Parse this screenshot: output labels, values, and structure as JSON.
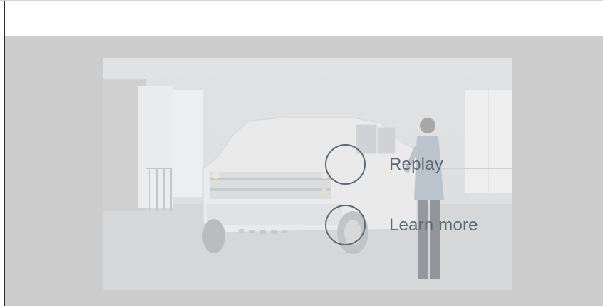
{
  "player": {
    "end_screen": {
      "actions": [
        {
          "label": "Replay",
          "icon": "replay-ring-icon"
        },
        {
          "label": "Learn more",
          "icon": "learn-more-ring-icon"
        }
      ],
      "accent_color": "#5d6a72"
    },
    "poster": {
      "subject": "white-pickup-truck-showroom"
    }
  }
}
